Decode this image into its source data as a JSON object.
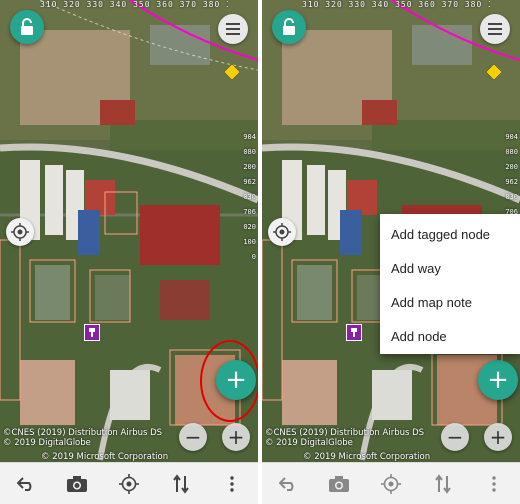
{
  "scale_top_text": "310 320 330 340 350 360 370 380 390 410",
  "scale_right_text": "9040802009620307060201000",
  "attribution": {
    "line1": "©CNES (2019) Distribution Airbus DS",
    "line2": "© 2019 DigitalGlobe",
    "line3": "© 2019 Microsoft Corporation"
  },
  "fab": {
    "label": "+"
  },
  "zoom": {
    "out": "−",
    "in": "+"
  },
  "popup_menu": {
    "items": [
      "Add tagged node",
      "Add way",
      "Add map note",
      "Add node"
    ]
  },
  "icons": {
    "lock": "lock-open-icon",
    "menu": "menu-icon",
    "gps": "gps-crosshair-icon",
    "undo": "undo-icon",
    "camera": "camera-icon",
    "follow": "gps-follow-icon",
    "transfer": "transfer-icon",
    "overflow": "overflow-icon"
  },
  "colors": {
    "accent": "#26a68f",
    "highlight": "#e00000",
    "note": "#8a1fa8",
    "boundary": "#ff00cc"
  }
}
